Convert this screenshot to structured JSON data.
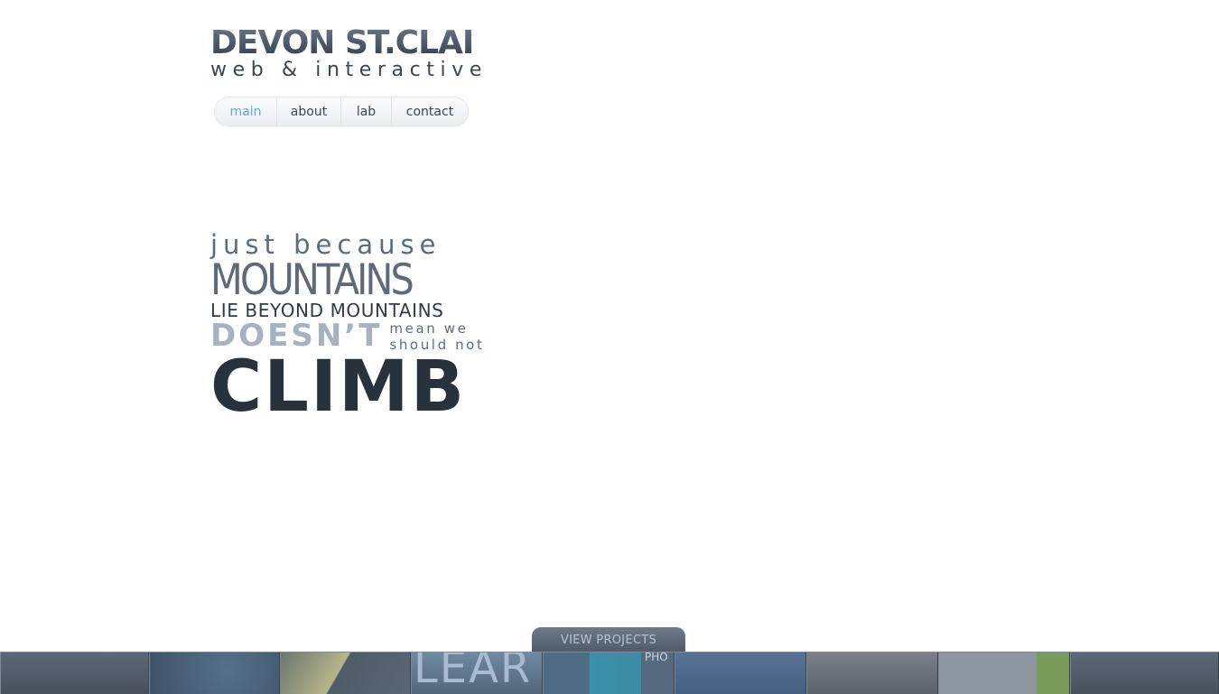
{
  "logo": {
    "title": "DEVON ST.CLAIR",
    "subtitle": "web & interactive"
  },
  "nav": {
    "items": [
      {
        "label": "main",
        "active": true
      },
      {
        "label": "about",
        "active": false
      },
      {
        "label": "lab",
        "active": false
      },
      {
        "label": "contact",
        "active": false
      }
    ]
  },
  "quote": {
    "line1": "just because",
    "line2": "MOUNTAINS",
    "line3": "LIE BEYOND MOUNTAINS",
    "line4_big": "DOESN’T",
    "line4_small_1": "mean we",
    "line4_small_2": "should not",
    "line5": "CLIMB"
  },
  "projects": {
    "tab_label": "VIEW PROJECTS",
    "thumb_text_1": "LEAR",
    "thumb_text_2": "PHO"
  },
  "colors": {
    "accent": "#6aa9cf",
    "text_dark": "#27323d",
    "strip": "#555f6c"
  }
}
